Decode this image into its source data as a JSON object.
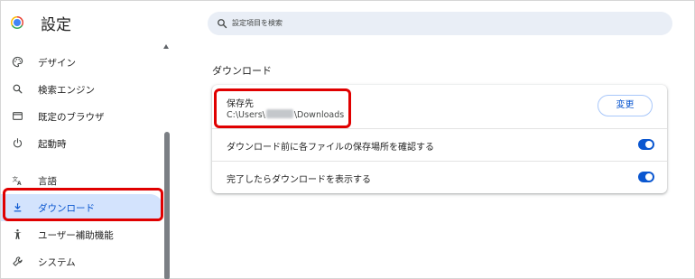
{
  "header": {
    "title": "設定",
    "search_placeholder": "設定項目を検索",
    "logo_icon": "chrome-logo-icon"
  },
  "sidebar": {
    "items": [
      {
        "label": "デザイン",
        "icon": "palette-icon",
        "active": false
      },
      {
        "label": "検索エンジン",
        "icon": "search-icon",
        "active": false
      },
      {
        "label": "既定のブラウザ",
        "icon": "browser-window-icon",
        "active": false
      },
      {
        "label": "起動時",
        "icon": "power-icon",
        "active": false
      },
      {
        "label": "言語",
        "icon": "translate-icon",
        "active": false
      },
      {
        "label": "ダウンロード",
        "icon": "download-icon",
        "active": true
      },
      {
        "label": "ユーザー補助機能",
        "icon": "accessibility-icon",
        "active": false
      },
      {
        "label": "システム",
        "icon": "wrench-icon",
        "active": false
      }
    ]
  },
  "main": {
    "section_title": "ダウンロード",
    "location": {
      "label": "保存先",
      "path_prefix": "C:\\Users\\",
      "path_suffix": "\\Downloads",
      "change_label": "変更"
    },
    "settings": [
      {
        "label": "ダウンロード前に各ファイルの保存場所を確認する",
        "enabled": true
      },
      {
        "label": "完了したらダウンロードを表示する",
        "enabled": true
      }
    ]
  },
  "colors": {
    "accent": "#0b57d0",
    "active_bg": "#d3e3fd",
    "highlight": "#e00000",
    "search_bg": "#e9eef6"
  }
}
